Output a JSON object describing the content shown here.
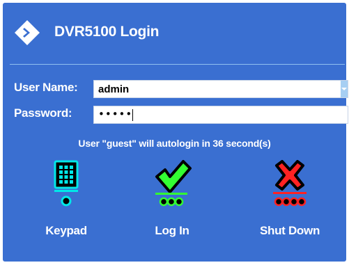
{
  "window": {
    "title": "DVR5100 Login"
  },
  "form": {
    "user_name_label": "User Name:",
    "user_name_value": "admin",
    "password_label": "Password:",
    "password_masked": "•••••"
  },
  "notice": "User \"guest\" will autologin in 36 second(s)",
  "actions": [
    {
      "label": "Keypad",
      "icon": "keypad-icon"
    },
    {
      "label": "Log In",
      "icon": "checkmark-icon"
    },
    {
      "label": "Shut Down",
      "icon": "close-x-icon"
    }
  ],
  "colors": {
    "background": "#3a6fd1",
    "divider": "#8fc0f0",
    "keypad": "#00e8e8",
    "login": "#33ff33",
    "shutdown": "#ff2222"
  }
}
